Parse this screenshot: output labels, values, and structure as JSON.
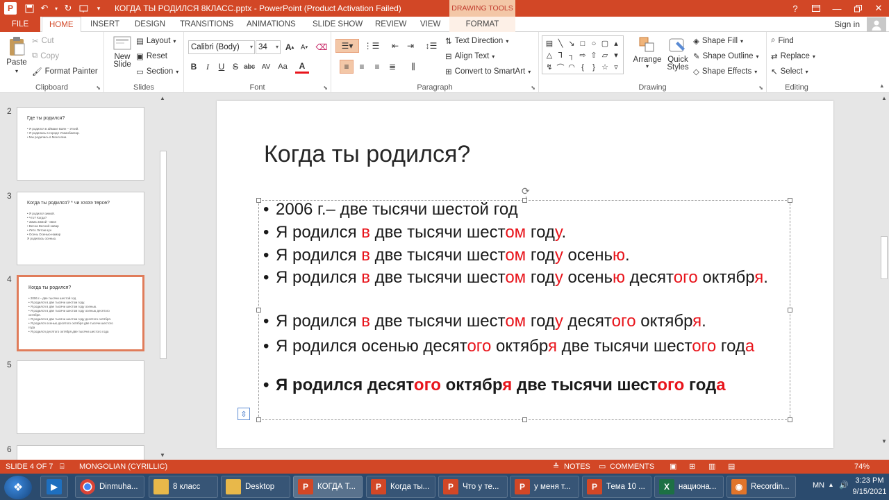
{
  "titlebar": {
    "title": "КОГДА ТЫ РОДИЛСЯ 8КЛАСС.pptx - PowerPoint (Product Activation Failed)",
    "contextual_tab_header": "DRAWING TOOLS",
    "help_icon": "?"
  },
  "tabs": {
    "file": "FILE",
    "home": "HOME",
    "insert": "INSERT",
    "design": "DESIGN",
    "transitions": "TRANSITIONS",
    "animations": "ANIMATIONS",
    "slide_show": "SLIDE SHOW",
    "review": "REVIEW",
    "view": "VIEW",
    "format": "FORMAT",
    "sign_in": "Sign in"
  },
  "ribbon": {
    "clipboard": {
      "label": "Clipboard",
      "paste": "Paste",
      "cut": "Cut",
      "copy": "Copy",
      "format_painter": "Format Painter"
    },
    "slides": {
      "label": "Slides",
      "new_slide_line1": "New",
      "new_slide_line2": "Slide",
      "layout": "Layout",
      "reset": "Reset",
      "section": "Section"
    },
    "font": {
      "label": "Font",
      "font_name": "Calibri (Body)",
      "font_size": "34"
    },
    "paragraph": {
      "label": "Paragraph",
      "text_direction": "Text Direction",
      "align_text": "Align Text",
      "convert_smartart": "Convert to SmartArt"
    },
    "drawing": {
      "label": "Drawing",
      "arrange": "Arrange",
      "quick_styles_line1": "Quick",
      "quick_styles_line2": "Styles",
      "shape_fill": "Shape Fill",
      "shape_outline": "Shape Outline",
      "shape_effects": "Shape Effects"
    },
    "editing": {
      "label": "Editing",
      "find": "Find",
      "replace": "Replace",
      "select": "Select"
    }
  },
  "thumbnails": [
    {
      "number": "2",
      "title": "Где ты родился?",
      "lines": [
        "• Я родился в аймаке Баян – Улгий.",
        "• Я родилась в городе Улаанбаатар.",
        "• Мы родились в Монголии."
      ]
    },
    {
      "number": "3",
      "title": "Когда ты родился? * чи хэзээ төрсө?",
      "lines": [
        "• Я родился зимой.",
        "• Что?            Когда?",
        "• Зима             Зимой - өвөл",
        "• Весна            Весной-хавар",
        "• Лето              Летом-зун",
        "• Осень            Осенью-намар",
        "  Я родилась осенью."
      ]
    },
    {
      "number": "4",
      "title": "Когда ты родился?",
      "lines": [
        "• 2006 г.– две тысячи шестой год",
        "• Я родился в две тысячи шестом году.",
        "• Я родился в две тысячи шестом году  осенью.",
        "• Я родился в две тысячи шестом году осенью десятого",
        "  октября.",
        "• Я родился в две тысячи шестом году десятого октября.",
        "• Я родился осенью  десятого октября две тысячи шестого",
        "  года",
        "• Я родился десятого октября две тысячи шестого года"
      ]
    },
    {
      "number": "5",
      "title": "",
      "lines": []
    },
    {
      "number": "6",
      "title": "",
      "lines": []
    }
  ],
  "slide": {
    "title": "Когда ты родился?",
    "bullets": [
      {
        "bold": false,
        "segments": [
          [
            "2006 г.– две тысячи шестой год",
            false
          ]
        ]
      },
      {
        "bold": false,
        "segments": [
          [
            "Я родился ",
            false
          ],
          [
            "в",
            true
          ],
          [
            " две тысячи шест",
            false
          ],
          [
            "ом",
            true
          ],
          [
            " год",
            false
          ],
          [
            "у",
            true
          ],
          [
            ".",
            false
          ]
        ]
      },
      {
        "bold": false,
        "segments": [
          [
            "Я родился ",
            false
          ],
          [
            "в",
            true
          ],
          [
            " две тысячи шест",
            false
          ],
          [
            "ом",
            true
          ],
          [
            " год",
            false
          ],
          [
            "у",
            true
          ],
          [
            "  осень",
            false
          ],
          [
            "ю",
            true
          ],
          [
            ".",
            false
          ]
        ]
      },
      {
        "bold": false,
        "segments": [
          [
            "Я родился ",
            false
          ],
          [
            "в",
            true
          ],
          [
            " две тысячи шест",
            false
          ],
          [
            "ом",
            true
          ],
          [
            " год",
            false
          ],
          [
            "у",
            true
          ],
          [
            " осень",
            false
          ],
          [
            "ю",
            true
          ],
          [
            " десят",
            false
          ],
          [
            "ого",
            true
          ],
          [
            " октябр",
            false
          ],
          [
            "я",
            true
          ],
          [
            ".",
            false
          ]
        ]
      },
      {
        "bold": false,
        "segments": [
          [
            "Я родился ",
            false
          ],
          [
            "в",
            true
          ],
          [
            " две тысячи шест",
            false
          ],
          [
            "ом",
            true
          ],
          [
            " год",
            false
          ],
          [
            "у",
            true
          ],
          [
            " десят",
            false
          ],
          [
            "ого",
            true
          ],
          [
            " октябр",
            false
          ],
          [
            "я",
            true
          ],
          [
            ".",
            false
          ]
        ]
      },
      {
        "bold": false,
        "segments": [
          [
            "Я родился осенью  десят",
            false
          ],
          [
            "ого",
            true
          ],
          [
            " октябр",
            false
          ],
          [
            "я",
            true
          ],
          [
            " две тысячи шест",
            false
          ],
          [
            "ого",
            true
          ],
          [
            " год",
            false
          ],
          [
            "а",
            true
          ]
        ]
      },
      {
        "bold": true,
        "segments": [
          [
            "Я родился десят",
            false
          ],
          [
            "ого",
            true
          ],
          [
            " октябр",
            false
          ],
          [
            "я",
            true
          ],
          [
            " две тысячи шест",
            false
          ],
          [
            "ого",
            true
          ],
          [
            " год",
            false
          ],
          [
            "а",
            true
          ]
        ]
      }
    ]
  },
  "statusbar": {
    "slide_info": "SLIDE 4 OF 7",
    "language": "MONGOLIAN (CYRILLIC)",
    "notes": "NOTES",
    "comments": "COMMENTS",
    "zoom": "74%"
  },
  "taskbar": {
    "items": [
      {
        "label": "Dinmuha...",
        "icon": "chrome-icon"
      },
      {
        "label": "8 класс",
        "icon": "folder-icon"
      },
      {
        "label": "Desktop",
        "icon": "folder-icon"
      },
      {
        "label": "КОГДА Т...",
        "icon": "powerpoint-icon",
        "active": true
      },
      {
        "label": "Когда ты...",
        "icon": "powerpoint-icon"
      },
      {
        "label": "Что у те...",
        "icon": "powerpoint-icon"
      },
      {
        "label": "у меня т...",
        "icon": "powerpoint-icon"
      },
      {
        "label": "Тема 10 ...",
        "icon": "powerpoint-icon"
      },
      {
        "label": "национа...",
        "icon": "excel-icon"
      },
      {
        "label": "Recordin...",
        "icon": "recorder-icon"
      }
    ],
    "language": "MN",
    "time": "3:23 PM",
    "date": "9/15/2021"
  },
  "colors": {
    "accent": "#d24726",
    "highlight_text": "#e8141b",
    "taskbar": "#2b4b6e"
  }
}
